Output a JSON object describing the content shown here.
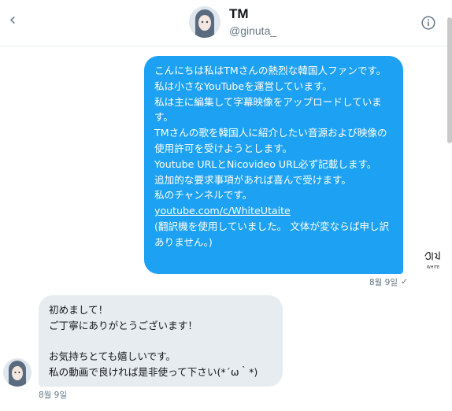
{
  "header": {
    "name": "TM",
    "handle": "@ginuta_",
    "back_icon": "chevron-left-icon",
    "info_icon": "info-icon"
  },
  "messages": [
    {
      "direction": "outgoing",
      "lines": [
        "こんにちは私はTMさんの熱烈な韓国人ファンです。",
        "私は小さなYouTubeを運営しています。",
        "私は主に編集して字幕映像をアップロードしています。",
        "TMさんの歌を韓国人に紹介したい音源および映像の使用許可を受けようとします。",
        "Youtube URLとNicovideo URL必ず記載します。",
        "追加的な要求事項があれば喜んで受けます。",
        "私のチャンネルです。"
      ],
      "link": "youtube.com/c/WhiteUtaite",
      "note": "(翻訳機を使用していました。 文体が変ならば申し訳ありません。)",
      "timestamp": "8월 9일",
      "status_icon": "check-icon",
      "signature_text": "WHITE"
    },
    {
      "direction": "incoming",
      "text": "初めまして！\nご丁寧にありがとうございます！\n\nお気持ちとても嬉しいです。\n私の動画で良ければ是非使って下さい(*´ω｀*)",
      "timestamp": "8월 9일"
    }
  ],
  "colors": {
    "outgoing_bubble": "#1da1f2",
    "incoming_bubble": "#e6ecf0",
    "muted": "#657786"
  }
}
